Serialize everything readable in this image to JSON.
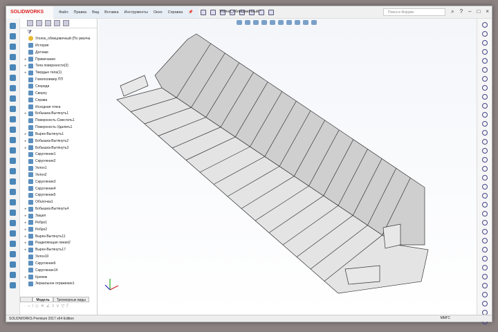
{
  "app": {
    "logo": "SOLIDWORKS",
    "doc_title": "Уголок_облицовочный *",
    "search_placeholder": "Поиск в Форуме"
  },
  "menu": [
    "Файл",
    "Правка",
    "Вид",
    "Вставка",
    "Инструменты",
    "Окно",
    "Справка"
  ],
  "tree": {
    "root": "Уголок_облицовочный  (По умолча",
    "items": [
      {
        "label": "История",
        "arrow": ""
      },
      {
        "label": "Датчики",
        "arrow": ""
      },
      {
        "label": "Примечания",
        "arrow": "▸"
      },
      {
        "label": "Тела поверхности(3)",
        "arrow": "▸"
      },
      {
        "label": "Твердые тела(1)",
        "arrow": "▸"
      },
      {
        "label": "Гомополимер ПП",
        "arrow": ""
      },
      {
        "label": "Спереди",
        "arrow": ""
      },
      {
        "label": "Сверху",
        "arrow": ""
      },
      {
        "label": "Справа",
        "arrow": ""
      },
      {
        "label": "Исходная точка",
        "arrow": ""
      },
      {
        "label": "Бобышка-Вытянуть1",
        "arrow": "▸"
      },
      {
        "label": "Поверхность-Сместить1",
        "arrow": ""
      },
      {
        "label": "Поверхность-Удалить1",
        "arrow": ""
      },
      {
        "label": "Вырез-Вытянуть1",
        "arrow": "▸"
      },
      {
        "label": "Бобышка-Вытянуть2",
        "arrow": "▸"
      },
      {
        "label": "Бобышка-Вытянуть3",
        "arrow": "▸"
      },
      {
        "label": "Скругление1",
        "arrow": ""
      },
      {
        "label": "Скругление2",
        "arrow": ""
      },
      {
        "label": "Уклон1",
        "arrow": ""
      },
      {
        "label": "Уклон2",
        "arrow": ""
      },
      {
        "label": "Скругление3",
        "arrow": ""
      },
      {
        "label": "Скругление4",
        "arrow": ""
      },
      {
        "label": "Скругление5",
        "arrow": ""
      },
      {
        "label": "Оболочка1",
        "arrow": ""
      },
      {
        "label": "Бобышка-Вытянуть4",
        "arrow": "▸"
      },
      {
        "label": "Защел",
        "arrow": "▸"
      },
      {
        "label": "Ребро1",
        "arrow": "▸"
      },
      {
        "label": "Ребро2",
        "arrow": "▸"
      },
      {
        "label": "Вырез-Вытянуть11",
        "arrow": "▸"
      },
      {
        "label": "Разделяющая линия2",
        "arrow": "▸"
      },
      {
        "label": "Вырез-Вытянуть17",
        "arrow": "▸"
      },
      {
        "label": "Уклон10",
        "arrow": ""
      },
      {
        "label": "Скругление6",
        "arrow": ""
      },
      {
        "label": "Скругление14",
        "arrow": ""
      },
      {
        "label": "Крепеж",
        "arrow": "▸"
      },
      {
        "label": "Зеркальное отражение1",
        "arrow": ""
      }
    ]
  },
  "bottom_tabs": [
    "Модель",
    "Трехмерные виды"
  ],
  "status": {
    "edition": "SOLIDWORKS Premium 2017 x64 Edition",
    "units": "ММГС"
  }
}
